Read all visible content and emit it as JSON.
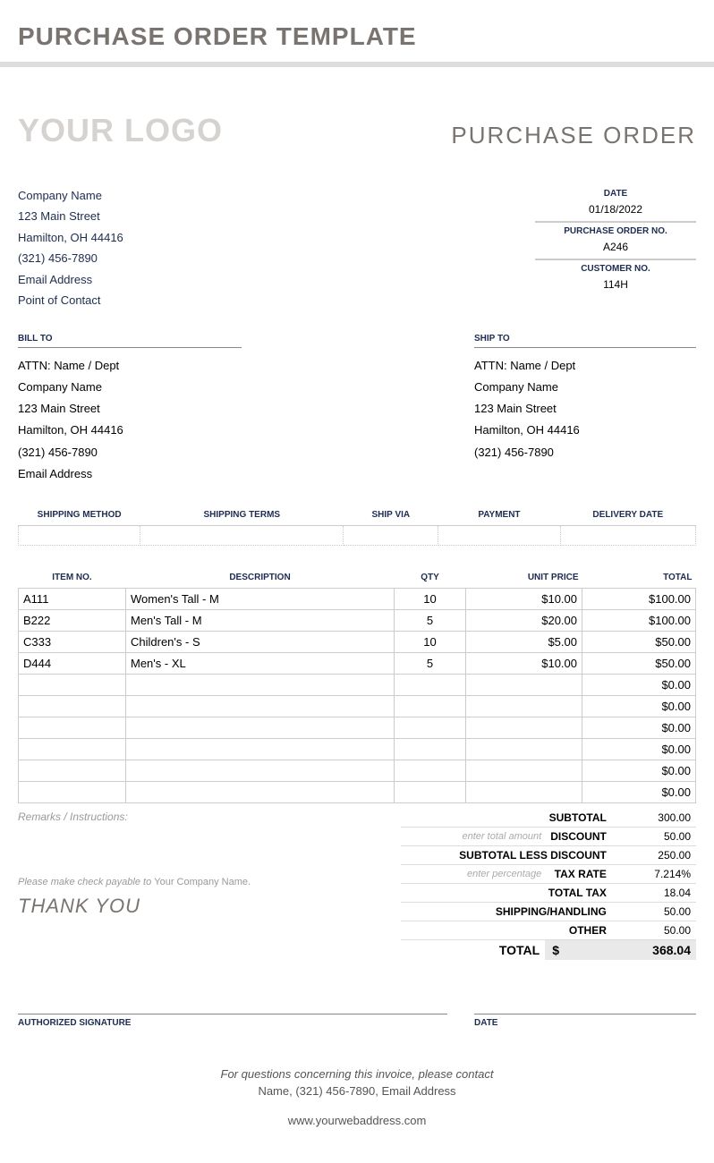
{
  "page_title": "PURCHASE ORDER TEMPLATE",
  "logo_text": "YOUR LOGO",
  "doc_type": "PURCHASE ORDER",
  "company": {
    "name": "Company Name",
    "street": "123 Main Street",
    "city": "Hamilton, OH 44416",
    "phone": "(321) 456-7890",
    "email": "Email Address",
    "poc": "Point of Contact"
  },
  "meta": {
    "date_label": "DATE",
    "date": "01/18/2022",
    "po_label": "PURCHASE ORDER NO.",
    "po": "A246",
    "cust_label": "CUSTOMER NO.",
    "cust": "114H"
  },
  "billto_label": "BILL TO",
  "shipto_label": "SHIP TO",
  "billto": {
    "attn": "ATTN: Name / Dept",
    "company": "Company Name",
    "street": "123 Main Street",
    "city": "Hamilton, OH 44416",
    "phone": "(321) 456-7890",
    "email": "Email Address"
  },
  "shipto": {
    "attn": "ATTN: Name / Dept",
    "company": "Company Name",
    "street": "123 Main Street",
    "city": "Hamilton, OH 44416",
    "phone": "(321) 456-7890"
  },
  "ship_headers": {
    "method": "SHIPPING METHOD",
    "terms": "SHIPPING TERMS",
    "via": "SHIP VIA",
    "payment": "PAYMENT",
    "delivery": "DELIVERY DATE"
  },
  "item_headers": {
    "itemno": "ITEM NO.",
    "desc": "DESCRIPTION",
    "qty": "QTY",
    "unit": "UNIT PRICE",
    "total": "TOTAL"
  },
  "items": [
    {
      "no": "A111",
      "desc": "Women's Tall - M",
      "qty": "10",
      "unit": "$10.00",
      "total": "$100.00"
    },
    {
      "no": "B222",
      "desc": "Men's Tall - M",
      "qty": "5",
      "unit": "$20.00",
      "total": "$100.00"
    },
    {
      "no": "C333",
      "desc": "Children's - S",
      "qty": "10",
      "unit": "$5.00",
      "total": "$50.00"
    },
    {
      "no": "D444",
      "desc": "Men's - XL",
      "qty": "5",
      "unit": "$10.00",
      "total": "$50.00"
    },
    {
      "no": "",
      "desc": "",
      "qty": "",
      "unit": "",
      "total": "$0.00"
    },
    {
      "no": "",
      "desc": "",
      "qty": "",
      "unit": "",
      "total": "$0.00"
    },
    {
      "no": "",
      "desc": "",
      "qty": "",
      "unit": "",
      "total": "$0.00"
    },
    {
      "no": "",
      "desc": "",
      "qty": "",
      "unit": "",
      "total": "$0.00"
    },
    {
      "no": "",
      "desc": "",
      "qty": "",
      "unit": "",
      "total": "$0.00"
    },
    {
      "no": "",
      "desc": "",
      "qty": "",
      "unit": "",
      "total": "$0.00"
    }
  ],
  "remarks_label": "Remarks / Instructions:",
  "totals": {
    "subtotal_label": "SUBTOTAL",
    "subtotal": "300.00",
    "discount_hint": "enter total amount",
    "discount_label": "DISCOUNT",
    "discount": "50.00",
    "subless_label": "SUBTOTAL LESS DISCOUNT",
    "subless": "250.00",
    "taxrate_hint": "enter percentage",
    "taxrate_label": "TAX RATE",
    "taxrate": "7.214%",
    "totaltax_label": "TOTAL TAX",
    "totaltax": "18.04",
    "shipping_label": "SHIPPING/HANDLING",
    "shipping": "50.00",
    "other_label": "OTHER",
    "other": "50.00",
    "grand_label": "TOTAL",
    "currency": "$",
    "grand": "368.04"
  },
  "payable_prefix": "Please make check payable to ",
  "payable_name": "Your Company Name.",
  "thanks": "THANK YOU",
  "sig_label": "AUTHORIZED SIGNATURE",
  "sig_date_label": "DATE",
  "footer": {
    "line1": "For questions concerning this invoice, please contact",
    "line2": "Name, (321) 456-7890, Email Address",
    "web": "www.yourwebaddress.com"
  }
}
